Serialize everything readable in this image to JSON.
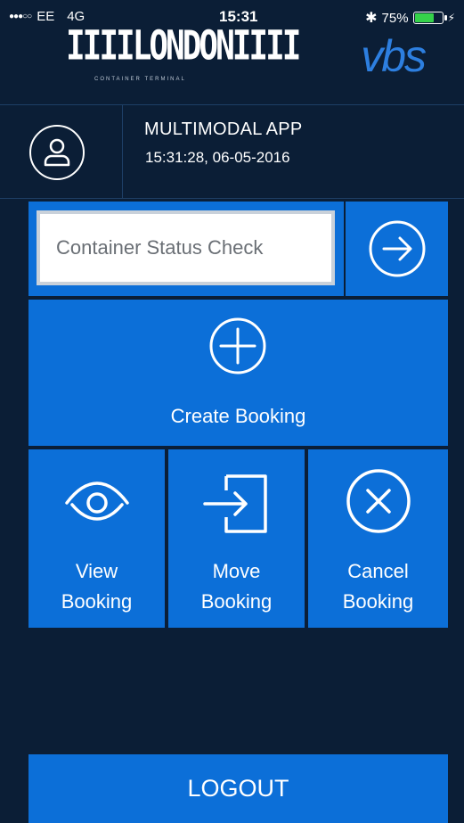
{
  "status_bar": {
    "carrier": "EE",
    "network": "4G",
    "time": "15:31",
    "battery": "75%",
    "battery_level": 0.75,
    "bluetooth_icon": "bluetooth-icon"
  },
  "header": {
    "logo_left": "IIIILONDONIIII",
    "logo_left_sub": "CONTAINER TERMINAL",
    "logo_right": "vbs",
    "app_title": "MULTIMODAL APP",
    "datetime": "15:31:28, 06-05-2016"
  },
  "search": {
    "placeholder": "Container Status Check",
    "value": ""
  },
  "tiles": {
    "create": "Create Booking",
    "view_line1": "View",
    "view_line2": "Booking",
    "move_line1": "Move",
    "move_line2": "Booking",
    "cancel_line1": "Cancel",
    "cancel_line2": "Booking"
  },
  "logout": "LOGOUT",
  "colors": {
    "background": "#0b1e36",
    "tile": "#0c6fd8",
    "battery_fill": "#35d24a"
  }
}
